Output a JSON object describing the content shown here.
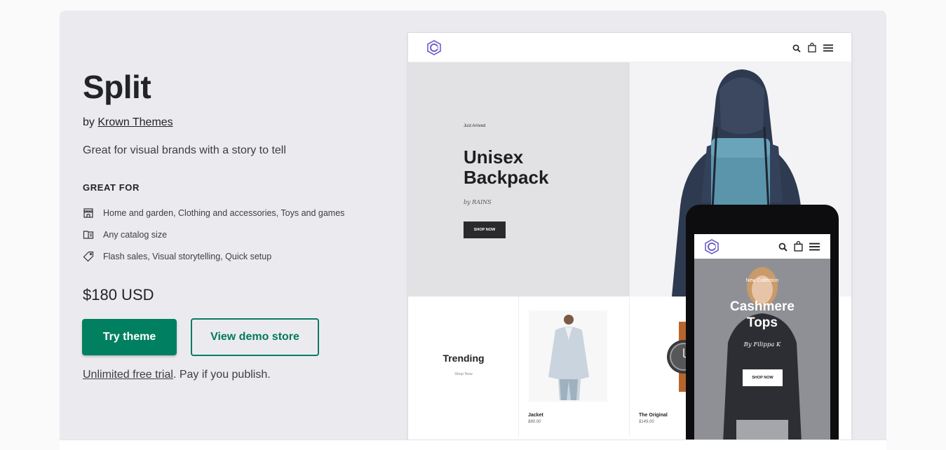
{
  "theme": {
    "title": "Split",
    "by_prefix": "by",
    "author": "Krown Themes",
    "tagline": "Great for visual brands with a story to tell",
    "great_for_heading": "GREAT FOR",
    "features": [
      {
        "icon": "store-icon",
        "text": "Home and garden, Clothing and accessories, Toys and games"
      },
      {
        "icon": "catalog-icon",
        "text": "Any catalog size"
      },
      {
        "icon": "tag-icon",
        "text": "Flash sales, Visual storytelling, Quick setup"
      }
    ],
    "price": "$180 USD",
    "try_button": "Try theme",
    "demo_button": "View demo store",
    "trial_link": "Unlimited free trial",
    "trial_rest": ". Pay if you publish."
  },
  "desktop_preview": {
    "eyebrow": "Just Arrived",
    "hero_title_line1": "Unisex",
    "hero_title_line2": "Backpack",
    "hero_by": "by RAINS",
    "hero_button": "SHOP NOW",
    "trending_title": "Trending",
    "trending_sub": "Shop Now",
    "products": [
      {
        "name": "Jacket",
        "price": "$80.00"
      },
      {
        "name": "The Original",
        "price": "$149.00"
      }
    ]
  },
  "mobile_preview": {
    "eyebrow": "New Collection",
    "title_line1": "Cashmere",
    "title_line2": "Tops",
    "by": "By Filippa K",
    "button": "SHOP NOW"
  },
  "colors": {
    "accent": "#008060",
    "card_bg": "#ebebef"
  }
}
